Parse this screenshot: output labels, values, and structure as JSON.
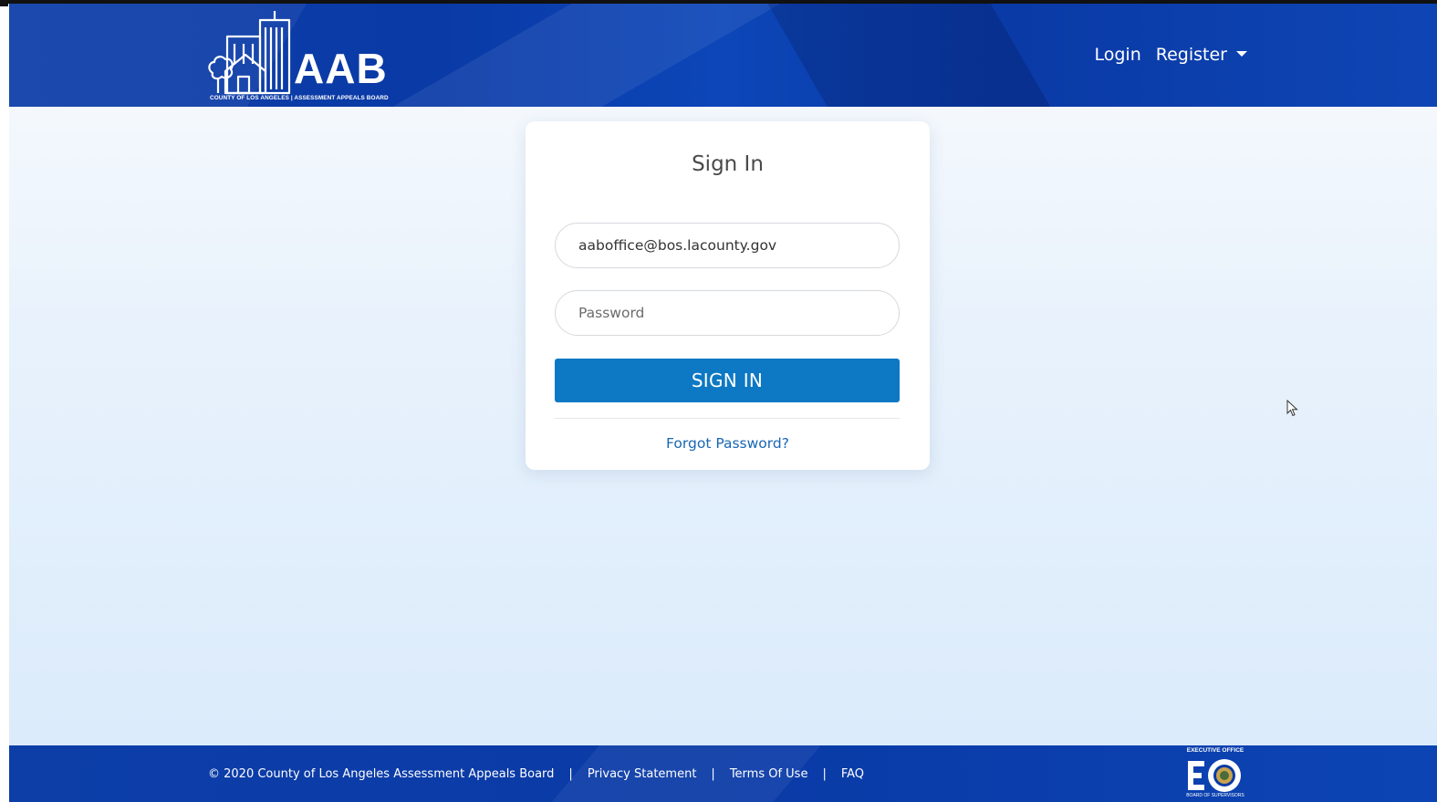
{
  "header": {
    "logo_text": "AAB",
    "logo_subtitle": "COUNTY OF LOS ANGELES | ASSESSMENT APPEALS BOARD",
    "nav": {
      "login": "Login",
      "register": "Register"
    }
  },
  "signin_card": {
    "title": "Sign In",
    "email_value": "aaboffice@bos.lacounty.gov",
    "password_placeholder": "Password",
    "signin_button": "SIGN IN",
    "forgot_password": "Forgot Password?"
  },
  "footer": {
    "copyright": "© 2020 County of Los Angeles Assessment Appeals Board",
    "links": [
      "Privacy Statement",
      "Terms Of Use",
      "FAQ"
    ],
    "separator": "|",
    "eo_logo_top": "EXECUTIVE OFFICE",
    "eo_logo_bottom": "BOARD OF SUPERVISORS"
  },
  "colors": {
    "header_blue": "#0a3aa6",
    "button_blue": "#0d78c3",
    "link_blue": "#1a66b3",
    "page_bg": "#e8f2fc"
  },
  "icons": {
    "logo": "city-skyline-logo-icon",
    "dropdown": "caret-down-icon",
    "cursor": "mouse-pointer-icon",
    "eo": "executive-office-seal-icon"
  }
}
